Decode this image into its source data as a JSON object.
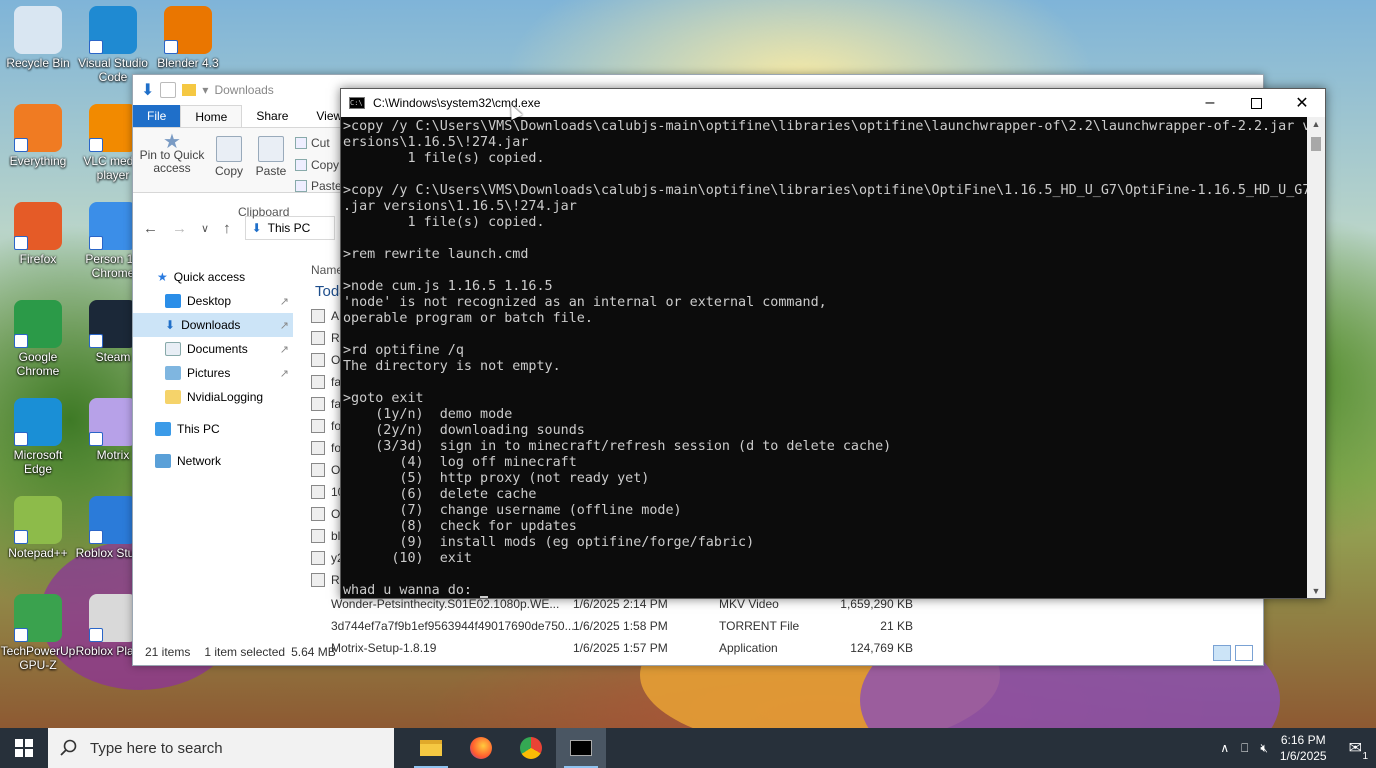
{
  "desktop": {
    "icons": [
      {
        "label": "Recycle Bin",
        "icon": "recycle-bin-icon",
        "color": "#d9e6f2"
      },
      {
        "label": "Visual Studio Code",
        "icon": "vscode-icon",
        "color": "#1f8ad2"
      },
      {
        "label": "Blender 4.3",
        "icon": "blender-icon",
        "color": "#ea7600"
      },
      {
        "label": "Everything",
        "icon": "everything-icon",
        "color": "#f07b22"
      },
      {
        "label": "VLC media player",
        "icon": "vlc-icon",
        "color": "#f28a00"
      },
      {
        "label": "Firefox",
        "icon": "firefox-icon",
        "color": "#e55b27"
      },
      {
        "label": "Person 1 - Chrome",
        "icon": "chrome-profile-icon",
        "color": "#3b8ee8"
      },
      {
        "label": "Google Chrome",
        "icon": "chrome-icon",
        "color": "#2b9a48"
      },
      {
        "label": "Steam",
        "icon": "steam-icon",
        "color": "#1b2838"
      },
      {
        "label": "Microsoft Edge",
        "icon": "edge-icon",
        "color": "#1a8fd6"
      },
      {
        "label": "Motrix",
        "icon": "motrix-icon",
        "color": "#b7a1e8"
      },
      {
        "label": "Notepad++",
        "icon": "notepadpp-icon",
        "color": "#8dbb4a"
      },
      {
        "label": "Roblox Studio",
        "icon": "roblox-studio-icon",
        "color": "#2b7bd9"
      },
      {
        "label": "TechPowerUp GPU-Z",
        "icon": "gpuz-icon",
        "color": "#3aa24e"
      },
      {
        "label": "Roblox Player",
        "icon": "roblox-player-icon",
        "color": "#d9d9d9"
      }
    ]
  },
  "explorer": {
    "title": "Downloads",
    "tabs": [
      "File",
      "Home",
      "Share",
      "View"
    ],
    "ribbon": {
      "pin_label": "Pin to Quick access",
      "copy_label": "Copy",
      "paste_label": "Paste",
      "cut_label": "Cut",
      "copy_path_label": "Copy path",
      "paste_shortcut_label": "Paste shortcut",
      "group_label": "Clipboard"
    },
    "address": "This PC",
    "column_name": "Name",
    "group_today": "Today",
    "nav": {
      "quick_access": "Quick access",
      "desktop": "Desktop",
      "downloads": "Downloads",
      "documents": "Documents",
      "pictures": "Pictures",
      "nvidia": "NvidiaLogging",
      "this_pc": "This PC",
      "network": "Network"
    },
    "partial_rows": [
      "A",
      "R",
      "O",
      "fa",
      "fa",
      "fo",
      "fo",
      "O",
      "10",
      "O",
      "bl",
      "y2",
      "R"
    ],
    "files": [
      {
        "name": "Wonder-Petsinthecity.S01E02.1080p.WE...",
        "date": "1/6/2025 2:14 PM",
        "type": "MKV Video",
        "size": "1,659,290 KB"
      },
      {
        "name": "3d744ef7a7f9b1ef9563944f49017690de750...",
        "date": "1/6/2025 1:58 PM",
        "type": "TORRENT File",
        "size": "21 KB"
      },
      {
        "name": "Motrix-Setup-1.8.19",
        "date": "1/6/2025 1:57 PM",
        "type": "Application",
        "size": "124,769 KB"
      }
    ],
    "status": {
      "items": "21 items",
      "selected": "1 item selected",
      "size": "5.64 MB"
    }
  },
  "cmd": {
    "title": "C:\\Windows\\system32\\cmd.exe",
    "lines": [
      ">copy /y C:\\Users\\VMS\\Downloads\\calubjs-main\\optifine\\libraries\\optifine\\launchwrapper-of\\2.2\\launchwrapper-of-2.2.jar v",
      "ersions\\1.16.5\\!274.jar",
      "        1 file(s) copied.",
      "",
      ">copy /y C:\\Users\\VMS\\Downloads\\calubjs-main\\optifine\\libraries\\optifine\\OptiFine\\1.16.5_HD_U_G7\\OptiFine-1.16.5_HD_U_G7",
      ".jar versions\\1.16.5\\!274.jar",
      "        1 file(s) copied.",
      "",
      ">rem rewrite launch.cmd",
      "",
      ">node cum.js 1.16.5 1.16.5",
      "'node' is not recognized as an internal or external command,",
      "operable program or batch file.",
      "",
      ">rd optifine /q",
      "The directory is not empty.",
      "",
      ">goto exit",
      "    (1y/n)  demo mode",
      "    (2y/n)  downloading sounds",
      "    (3/3d)  sign in to minecraft/refresh session (d to delete cache)",
      "       (4)  log off minecraft",
      "       (5)  http proxy (not ready yet)",
      "       (6)  delete cache",
      "       (7)  change username (offline mode)",
      "       (8)  check for updates",
      "       (9)  install mods (eg optifine/forge/fabric)",
      "      (10)  exit",
      "",
      "whad u wanna do: "
    ]
  },
  "taskbar": {
    "search_placeholder": "Type here to search",
    "time": "6:16 PM",
    "date": "1/6/2025",
    "notification_count": "1"
  }
}
